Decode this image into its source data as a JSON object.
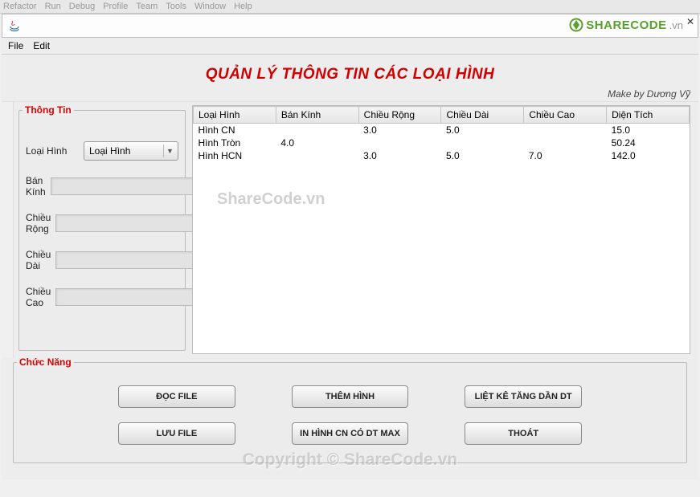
{
  "ide_menu": [
    "Refactor",
    "Run",
    "Debug",
    "Profile",
    "Team",
    "Tools",
    "Window",
    "Help"
  ],
  "app_menu": {
    "file": "File",
    "edit": "Edit"
  },
  "brand": {
    "main": "SHARECODE",
    "suffix": ".vn"
  },
  "title": "QUẢN LÝ THÔNG TIN CÁC LOẠI HÌNH",
  "credit": "Make by Dương Vỹ",
  "panels": {
    "info": "Thông Tin",
    "func": "Chức Năng"
  },
  "form": {
    "loai_hinh_label": "Loại Hình",
    "loai_hinh_value": "Loại Hình",
    "ban_kinh_label": "Bán Kính",
    "ban_kinh_value": "",
    "chieu_rong_label": "Chiều Rộng",
    "chieu_rong_value": "",
    "chieu_dai_label": "Chiều Dài",
    "chieu_dai_value": "",
    "chieu_cao_label": "Chiều Cao",
    "chieu_cao_value": ""
  },
  "table": {
    "headers": {
      "c0": "Loại Hình",
      "c1": "Bán Kính",
      "c2": "Chiều Rộng",
      "c3": "Chiều Dài",
      "c4": "Chiều Cao",
      "c5": "Diện Tích"
    },
    "rows": [
      {
        "c0": "Hình CN",
        "c1": "",
        "c2": "3.0",
        "c3": "5.0",
        "c4": "",
        "c5": "15.0"
      },
      {
        "c0": "Hình Tròn",
        "c1": "4.0",
        "c2": "",
        "c3": "",
        "c4": "",
        "c5": "50.24"
      },
      {
        "c0": "Hình HCN",
        "c1": "",
        "c2": "3.0",
        "c3": "5.0",
        "c4": "7.0",
        "c5": "142.0"
      }
    ]
  },
  "buttons": {
    "doc_file": "ĐỌC FILE",
    "them_hinh": "THÊM HÌNH",
    "liet_ke": "LIỆT KÊ TĂNG DẦN DT",
    "luu_file": "LƯU FILE",
    "in_hinh": "IN HÌNH CN CÓ DT MAX",
    "thoat": "THOÁT"
  },
  "watermarks": {
    "w1": "ShareCode.vn",
    "w2": "Copyright © ShareCode.vn"
  }
}
